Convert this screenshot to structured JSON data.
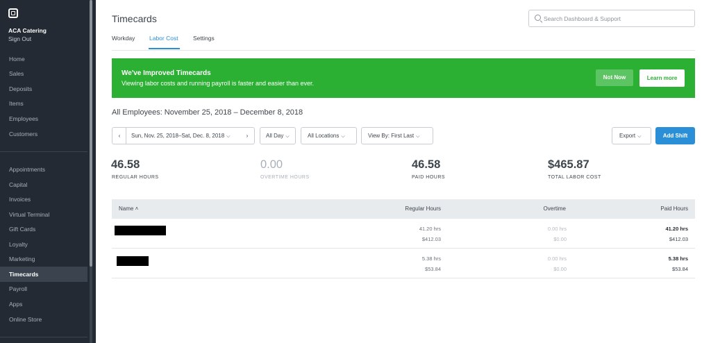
{
  "sidebar": {
    "business_name": "ACA Catering",
    "sign_out": "Sign Out",
    "items_top": [
      "Home",
      "Sales",
      "Deposits",
      "Items",
      "Employees",
      "Customers"
    ],
    "items_bottom": [
      "Appointments",
      "Capital",
      "Invoices",
      "Virtual Terminal",
      "Gift Cards",
      "Loyalty",
      "Marketing",
      "Timecards",
      "Payroll",
      "Apps",
      "Online Store"
    ],
    "active_item": "Timecards"
  },
  "header": {
    "title": "Timecards",
    "search_placeholder": "Search Dashboard & Support",
    "tabs": [
      "Workday",
      "Labor Cost",
      "Settings"
    ],
    "active_tab": "Labor Cost"
  },
  "banner": {
    "title": "We've Improved Timecards",
    "text": "Viewing labor costs and running payroll is faster and easier than ever.",
    "not_now": "Not Now",
    "learn_more": "Learn more",
    "color": "#2cb034"
  },
  "subtitle": "All Employees: November 25, 2018 – December 8, 2018",
  "filters": {
    "prev": "‹",
    "date_range": "Sun, Nov. 25, 2018–Sat, Dec. 8, 2018",
    "next": "›",
    "time": "All Day",
    "locations": "All Locations",
    "view_by": "View By: First Last",
    "export": "Export",
    "add_shift": "Add Shift",
    "accent_color": "#2a8fd6"
  },
  "stats": [
    {
      "value": "46.58",
      "label": "REGULAR HOURS"
    },
    {
      "value": "0.00",
      "label": "OVERTIME HOURS"
    },
    {
      "value": "46.58",
      "label": "PAID HOURS"
    },
    {
      "value": "$465.87",
      "label": "TOTAL LABOR COST"
    }
  ],
  "table": {
    "columns": [
      "Name",
      "Regular Hours",
      "Overtime",
      "Paid Hours"
    ],
    "sort_indicator": "˄",
    "rows": [
      {
        "regular_hours": "41.20 hrs",
        "regular_cost": "$412.03",
        "overtime_hours": "0.00 hrs",
        "overtime_cost": "$0.00",
        "paid_hours": "41.20 hrs",
        "paid_cost": "$412.03"
      },
      {
        "regular_hours": "5.38 hrs",
        "regular_cost": "$53.84",
        "overtime_hours": "0.00 hrs",
        "overtime_cost": "$0.00",
        "paid_hours": "5.38 hrs",
        "paid_cost": "$53.84"
      }
    ]
  }
}
